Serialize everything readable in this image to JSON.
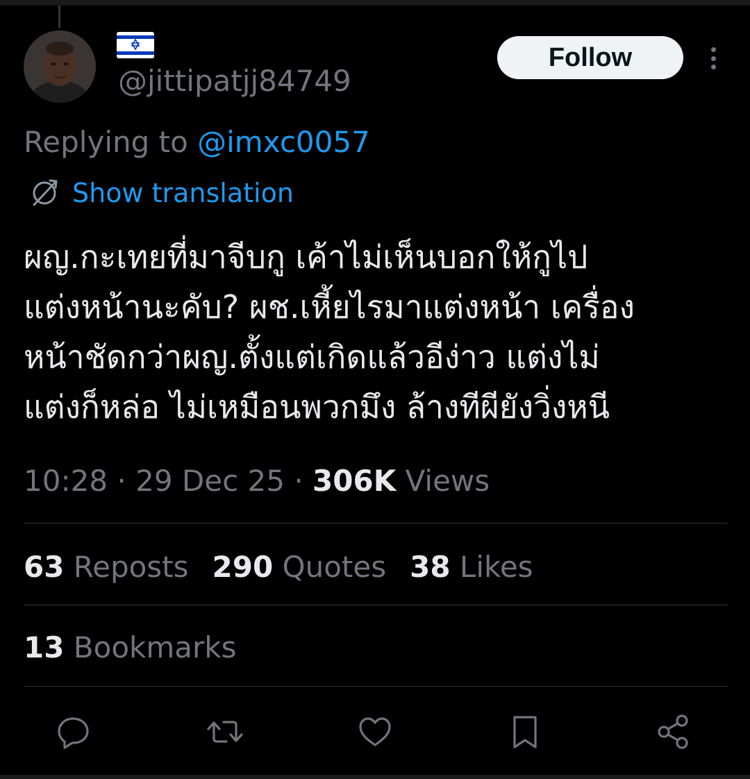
{
  "author": {
    "handle": "@jittipatjj84749",
    "flag_icon": "israel-flag-icon",
    "avatar_icon": "avatar-photo"
  },
  "follow_button": {
    "label": "Follow"
  },
  "more_icon": "more-vertical-icon",
  "reply_context": {
    "prefix": "Replying to ",
    "mention": "@imxc0057"
  },
  "translation": {
    "icon": "globe-icon",
    "label": "Show translation"
  },
  "tweet": {
    "lines": [
      "ผญ.กะเทยที่มาจีบกู เค้าไม่เห็นบอกให้กูไป",
      "แต่งหน้านะคับ? ผช.เหี้ยไรมาแต่งหน้า เครื่อง",
      "หน้าชัดกว่าผญ.ตั้งแต่เกิดแล้วอีง่าว แต่งไม่",
      "แต่งก็หล่อ ไม่เหมือนพวกมึง ล้างทีผียังวิ่งหนี"
    ]
  },
  "meta": {
    "time": "10:28",
    "separator": " · ",
    "date": "29 Dec 25",
    "views_count": "306K",
    "views_label": " Views"
  },
  "stats": {
    "reposts": {
      "count": "63",
      "label": " Reposts"
    },
    "quotes": {
      "count": "290",
      "label": " Quotes"
    },
    "likes": {
      "count": "38",
      "label": " Likes"
    },
    "bookmarks": {
      "count": "13",
      "label": " Bookmarks"
    }
  },
  "actions": [
    "reply-icon",
    "repost-icon",
    "like-icon",
    "bookmark-icon",
    "share-icon"
  ],
  "colors": {
    "background": "#000000",
    "text_primary": "#e7e9ea",
    "text_secondary": "#71767b",
    "link": "#1d9bf0",
    "divider": "#2f3336",
    "follow_button_bg": "#eff3f4"
  }
}
